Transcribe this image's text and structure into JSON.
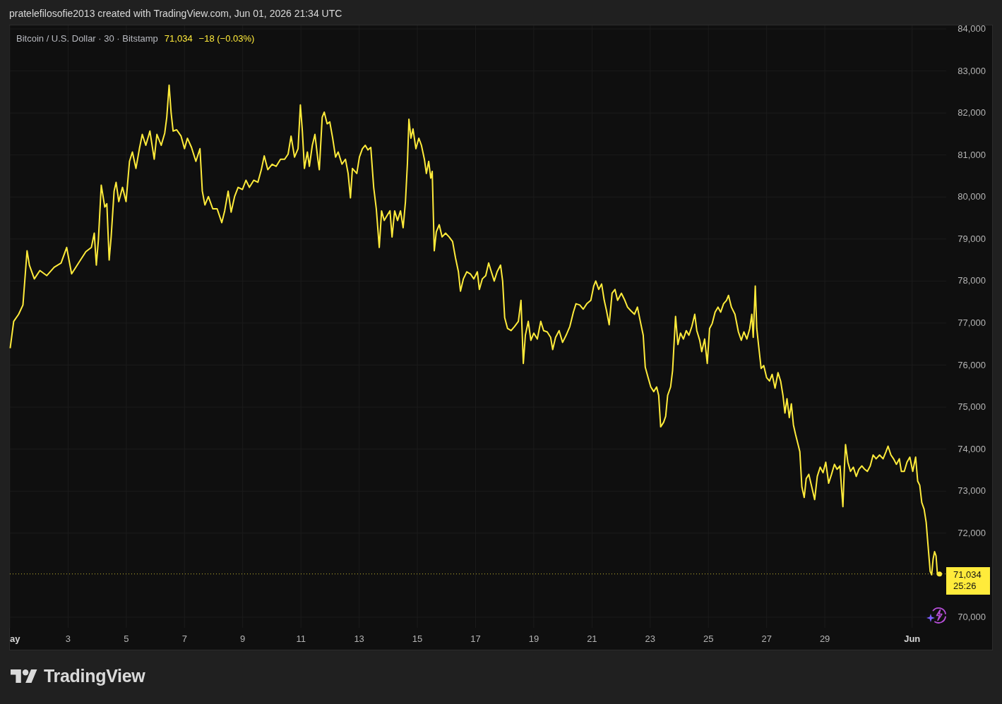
{
  "attribution": "pratelefilosofie2013 created with TradingView.com, Jun 01, 2026 21:34 UTC",
  "legend": {
    "symbol": "Bitcoin / U.S. Dollar · 30 · Bitstamp",
    "price": "71,034",
    "change": "−18 (−0.03%)"
  },
  "chart": {
    "chart_data": {
      "type": "line",
      "x": [
        1.01,
        1.13,
        1.3,
        1.45,
        1.59,
        1.67,
        1.84,
        2.03,
        2.27,
        2.52,
        2.76,
        2.95,
        3.12,
        3.36,
        3.61,
        3.8,
        3.9,
        3.97,
        4.04,
        4.14,
        4.26,
        4.33,
        4.41,
        4.48,
        4.58,
        4.65,
        4.74,
        4.87,
        4.99,
        5.11,
        5.21,
        5.33,
        5.45,
        5.55,
        5.67,
        5.81,
        5.96,
        6.05,
        6.2,
        6.32,
        6.39,
        6.47,
        6.54,
        6.61,
        6.73,
        6.88,
        7.0,
        7.1,
        7.24,
        7.39,
        7.53,
        7.61,
        7.7,
        7.82,
        7.97,
        8.12,
        8.28,
        8.38,
        8.5,
        8.6,
        8.72,
        8.84,
        8.99,
        9.11,
        9.23,
        9.38,
        9.52,
        9.64,
        9.74,
        9.86,
        10.01,
        10.15,
        10.3,
        10.44,
        10.56,
        10.66,
        10.78,
        10.9,
        10.98,
        11.05,
        11.12,
        11.22,
        11.29,
        11.39,
        11.48,
        11.58,
        11.63,
        11.73,
        11.8,
        11.9,
        11.99,
        12.09,
        12.19,
        12.28,
        12.41,
        12.53,
        12.62,
        12.7,
        12.77,
        12.92,
        13.01,
        13.11,
        13.21,
        13.3,
        13.4,
        13.5,
        13.59,
        13.69,
        13.77,
        13.86,
        13.96,
        14.06,
        14.13,
        14.22,
        14.32,
        14.42,
        14.51,
        14.59,
        14.66,
        14.71,
        14.78,
        14.85,
        14.95,
        15.05,
        15.14,
        15.24,
        15.31,
        15.39,
        15.46,
        15.51,
        15.58,
        15.65,
        15.75,
        15.85,
        15.97,
        16.09,
        16.21,
        16.31,
        16.41,
        16.48,
        16.58,
        16.7,
        16.82,
        16.94,
        17.06,
        17.13,
        17.23,
        17.35,
        17.45,
        17.54,
        17.64,
        17.74,
        17.86,
        17.93,
        18.0,
        18.1,
        18.22,
        18.34,
        18.47,
        18.56,
        18.64,
        18.71,
        18.81,
        18.9,
        19.0,
        19.12,
        19.24,
        19.34,
        19.46,
        19.58,
        19.65,
        19.75,
        19.87,
        19.99,
        20.11,
        20.24,
        20.36,
        20.45,
        20.58,
        20.7,
        20.82,
        20.96,
        21.06,
        21.13,
        21.23,
        21.33,
        21.42,
        21.5,
        21.59,
        21.69,
        21.79,
        21.88,
        22.01,
        22.13,
        22.22,
        22.34,
        22.46,
        22.56,
        22.66,
        22.76,
        22.83,
        22.93,
        23.02,
        23.12,
        23.22,
        23.29,
        23.36,
        23.46,
        23.53,
        23.6,
        23.7,
        23.77,
        23.87,
        23.95,
        24.04,
        24.14,
        24.24,
        24.33,
        24.43,
        24.53,
        24.6,
        24.7,
        24.77,
        24.87,
        24.96,
        25.04,
        25.13,
        25.23,
        25.33,
        25.42,
        25.52,
        25.62,
        25.69,
        25.79,
        25.91,
        26.03,
        26.13,
        26.22,
        26.32,
        26.42,
        26.49,
        26.54,
        26.61,
        26.66,
        26.73,
        26.81,
        26.9,
        27.0,
        27.1,
        27.19,
        27.29,
        27.39,
        27.48,
        27.56,
        27.63,
        27.7,
        27.78,
        27.85,
        27.92,
        27.99,
        28.07,
        28.14,
        28.21,
        28.29,
        28.36,
        28.45,
        28.55,
        28.65,
        28.74,
        28.84,
        28.94,
        29.03,
        29.13,
        29.23,
        29.33,
        29.42,
        29.52,
        29.57,
        29.62,
        29.67,
        29.71,
        29.79,
        29.88,
        29.98,
        30.08,
        30.17,
        30.27,
        30.37,
        30.46,
        30.56,
        30.66,
        30.76,
        30.88,
        31.0,
        31.1,
        31.17,
        31.27,
        31.36,
        31.46,
        31.56,
        31.63,
        31.73,
        31.82,
        31.92,
        32.02,
        32.12,
        32.19,
        32.26,
        32.33,
        32.41,
        32.48,
        32.55,
        32.62,
        32.67,
        32.72,
        32.77,
        32.82,
        32.87,
        32.94
      ],
      "series": [
        {
          "color": "#ffeb3b",
          "values": [
            76400,
            77040,
            77210,
            77430,
            78720,
            78380,
            78050,
            78250,
            78130,
            78330,
            78430,
            78800,
            78170,
            78430,
            78700,
            78800,
            79140,
            78380,
            78970,
            80280,
            79760,
            79840,
            78500,
            79050,
            80140,
            80350,
            79890,
            80230,
            79890,
            80850,
            81070,
            80680,
            81150,
            81490,
            81230,
            81570,
            80900,
            81490,
            81230,
            81520,
            81900,
            82660,
            81990,
            81570,
            81600,
            81450,
            81150,
            81400,
            81180,
            80850,
            81150,
            80140,
            79810,
            80010,
            79720,
            79720,
            79390,
            79670,
            80140,
            79640,
            80010,
            80230,
            80180,
            80400,
            80230,
            80400,
            80350,
            80650,
            80980,
            80650,
            80780,
            80730,
            80900,
            80900,
            81020,
            81450,
            80950,
            81150,
            82190,
            81570,
            80680,
            81070,
            80730,
            81230,
            81490,
            80900,
            80650,
            81900,
            82020,
            81740,
            81790,
            81400,
            80950,
            81070,
            80780,
            80900,
            80560,
            79980,
            80680,
            80560,
            80950,
            81150,
            81230,
            81120,
            81180,
            80230,
            79720,
            78800,
            79670,
            79440,
            79560,
            79670,
            79050,
            79670,
            79440,
            79670,
            79270,
            79890,
            80810,
            81850,
            81400,
            81620,
            81150,
            81400,
            81230,
            80900,
            80560,
            80850,
            80450,
            80610,
            78720,
            79170,
            79340,
            79050,
            79140,
            79050,
            78940,
            78550,
            78220,
            77760,
            78050,
            78220,
            78170,
            78050,
            78220,
            77800,
            78050,
            78130,
            78430,
            78220,
            78000,
            78220,
            78380,
            78000,
            77130,
            76870,
            76820,
            76920,
            77040,
            77540,
            76040,
            76710,
            77040,
            76590,
            76760,
            76620,
            77040,
            76820,
            76790,
            76660,
            76370,
            76660,
            76820,
            76540,
            76710,
            76920,
            77260,
            77460,
            77430,
            77330,
            77460,
            77540,
            77880,
            78000,
            77800,
            77930,
            77540,
            77290,
            76960,
            77710,
            77800,
            77540,
            77710,
            77540,
            77380,
            77290,
            77210,
            77380,
            77040,
            76710,
            75950,
            75700,
            75480,
            75370,
            75480,
            75280,
            74530,
            74640,
            74780,
            75280,
            75480,
            75870,
            77160,
            76490,
            76760,
            76620,
            76820,
            76710,
            76920,
            77210,
            76820,
            76590,
            76320,
            76620,
            76040,
            76870,
            76990,
            77260,
            77380,
            77260,
            77460,
            77540,
            77660,
            77380,
            77210,
            76790,
            76590,
            76790,
            76620,
            76870,
            77210,
            76660,
            77880,
            76870,
            76420,
            75920,
            75990,
            75700,
            75620,
            75780,
            75450,
            75820,
            75620,
            75280,
            74860,
            75200,
            74750,
            75080,
            74580,
            74360,
            74140,
            73940,
            73100,
            72850,
            73300,
            73400,
            73100,
            72800,
            73350,
            73570,
            73440,
            73690,
            73190,
            73400,
            73640,
            73520,
            73600,
            73100,
            72630,
            73520,
            74110,
            73690,
            73470,
            73570,
            73350,
            73520,
            73600,
            73520,
            73470,
            73600,
            73860,
            73770,
            73860,
            73770,
            73940,
            74070,
            73860,
            73770,
            73640,
            73770,
            73470,
            73470,
            73690,
            73810,
            73470,
            73810,
            73240,
            73140,
            72730,
            72570,
            72260,
            71680,
            71090,
            71010,
            71390,
            71560,
            71460,
            71010,
            71030
          ]
        }
      ],
      "ref_lines": [
        {
          "axis": "y",
          "value": 71030
        }
      ],
      "grid": true,
      "xlim": [
        1,
        33.17
      ],
      "ylim": [
        69748,
        84084
      ],
      "xticks": [
        {
          "value": 1,
          "label": "ay"
        },
        {
          "value": 3,
          "label": "3"
        },
        {
          "value": 5,
          "label": "5"
        },
        {
          "value": 7,
          "label": "7"
        },
        {
          "value": 9,
          "label": "9"
        },
        {
          "value": 11,
          "label": "11"
        },
        {
          "value": 13,
          "label": "13"
        },
        {
          "value": 15,
          "label": "15"
        },
        {
          "value": 17,
          "label": "17"
        },
        {
          "value": 19,
          "label": "19"
        },
        {
          "value": 21,
          "label": "21"
        },
        {
          "value": 23,
          "label": "23"
        },
        {
          "value": 25,
          "label": "25"
        },
        {
          "value": 27,
          "label": "27"
        },
        {
          "value": 29,
          "label": "29"
        },
        {
          "value": 32,
          "label": "Jun"
        }
      ],
      "yticks": [
        {
          "value": 84000,
          "label": "84,000"
        },
        {
          "value": 83000,
          "label": "83,000"
        },
        {
          "value": 82000,
          "label": "82,000"
        },
        {
          "value": 81000,
          "label": "81,000"
        },
        {
          "value": 80000,
          "label": "80,000"
        },
        {
          "value": 79000,
          "label": "79,000"
        },
        {
          "value": 78000,
          "label": "78,000"
        },
        {
          "value": 77000,
          "label": "77,000"
        },
        {
          "value": 76000,
          "label": "76,000"
        },
        {
          "value": 75000,
          "label": "75,000"
        },
        {
          "value": 74000,
          "label": "74,000"
        },
        {
          "value": 73000,
          "label": "73,000"
        },
        {
          "value": 72000,
          "label": "72,000"
        },
        {
          "value": 70000,
          "label": "70,000"
        }
      ]
    },
    "last_price_label": {
      "price": "71,034",
      "countdown": "25:26"
    }
  },
  "footer": {
    "logo_text": "TradingView"
  }
}
